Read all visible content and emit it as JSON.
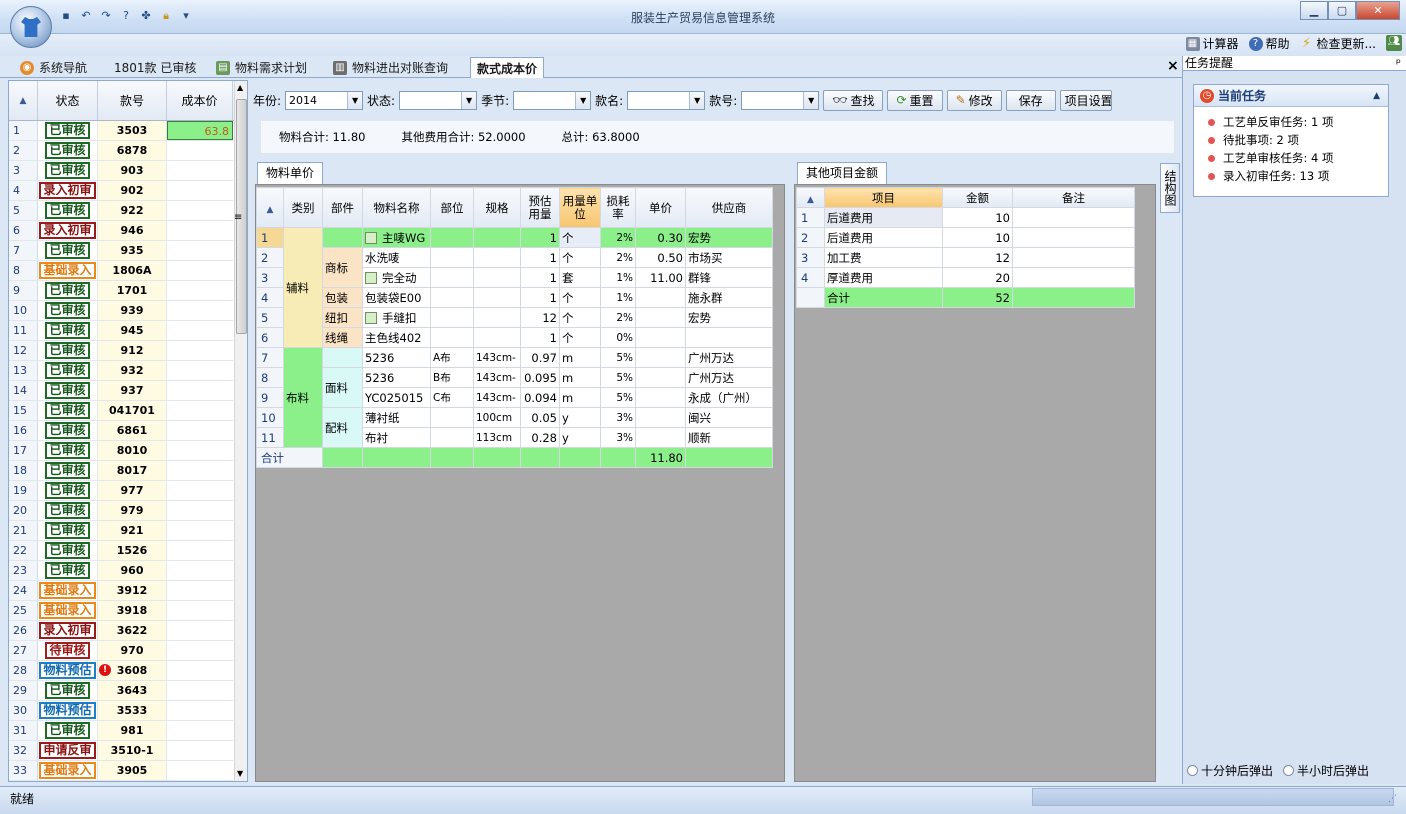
{
  "app": {
    "title": "服装生产贸易信息管理系统",
    "window_buttons": {
      "minimize": "▁",
      "maximize": "▢",
      "close": "✕"
    }
  },
  "toolbar_top": {
    "calculator": "计算器",
    "help": "帮助",
    "check_update": "检查更新..."
  },
  "tabs": [
    {
      "label": "系统导航"
    },
    {
      "label": "1801款 已审核"
    },
    {
      "label": "物料需求计划"
    },
    {
      "label": "物料进出对账查询"
    },
    {
      "label": "款式成本价"
    }
  ],
  "tab_close": "×",
  "left_list": {
    "headers": {
      "status": "状态",
      "style_no": "款号",
      "cost": "成本价"
    },
    "rows": [
      {
        "n": "1",
        "status": "已审核",
        "kind": "ok",
        "style": "3503",
        "cost": "63.8"
      },
      {
        "n": "2",
        "status": "已审核",
        "kind": "ok",
        "style": "6878",
        "cost": ""
      },
      {
        "n": "3",
        "status": "已审核",
        "kind": "ok",
        "style": "903",
        "cost": ""
      },
      {
        "n": "4",
        "status": "录入初审",
        "kind": "init",
        "style": "902",
        "cost": ""
      },
      {
        "n": "5",
        "status": "已审核",
        "kind": "ok",
        "style": "922",
        "cost": ""
      },
      {
        "n": "6",
        "status": "录入初审",
        "kind": "init",
        "style": "946",
        "cost": ""
      },
      {
        "n": "7",
        "status": "已审核",
        "kind": "ok",
        "style": "935",
        "cost": ""
      },
      {
        "n": "8",
        "status": "基础录入",
        "kind": "base",
        "style": "1806A",
        "cost": ""
      },
      {
        "n": "9",
        "status": "已审核",
        "kind": "ok",
        "style": "1701",
        "cost": ""
      },
      {
        "n": "10",
        "status": "已审核",
        "kind": "ok",
        "style": "939",
        "cost": ""
      },
      {
        "n": "11",
        "status": "已审核",
        "kind": "ok",
        "style": "945",
        "cost": ""
      },
      {
        "n": "12",
        "status": "已审核",
        "kind": "ok",
        "style": "912",
        "cost": ""
      },
      {
        "n": "13",
        "status": "已审核",
        "kind": "ok",
        "style": "932",
        "cost": ""
      },
      {
        "n": "14",
        "status": "已审核",
        "kind": "ok",
        "style": "937",
        "cost": ""
      },
      {
        "n": "15",
        "status": "已审核",
        "kind": "ok",
        "style": "041701",
        "cost": ""
      },
      {
        "n": "16",
        "status": "已审核",
        "kind": "ok",
        "style": "6861",
        "cost": ""
      },
      {
        "n": "17",
        "status": "已审核",
        "kind": "ok",
        "style": "8010",
        "cost": ""
      },
      {
        "n": "18",
        "status": "已审核",
        "kind": "ok",
        "style": "8017",
        "cost": ""
      },
      {
        "n": "19",
        "status": "已审核",
        "kind": "ok",
        "style": "977",
        "cost": ""
      },
      {
        "n": "20",
        "status": "已审核",
        "kind": "ok",
        "style": "979",
        "cost": ""
      },
      {
        "n": "21",
        "status": "已审核",
        "kind": "ok",
        "style": "921",
        "cost": ""
      },
      {
        "n": "22",
        "status": "已审核",
        "kind": "ok",
        "style": "1526",
        "cost": ""
      },
      {
        "n": "23",
        "status": "已审核",
        "kind": "ok",
        "style": "960",
        "cost": ""
      },
      {
        "n": "24",
        "status": "基础录入",
        "kind": "base",
        "style": "3912",
        "cost": ""
      },
      {
        "n": "25",
        "status": "基础录入",
        "kind": "base",
        "style": "3918",
        "cost": ""
      },
      {
        "n": "26",
        "status": "录入初审",
        "kind": "init",
        "style": "3622",
        "cost": ""
      },
      {
        "n": "27",
        "status": "待审核",
        "kind": "wait",
        "style": "970",
        "cost": ""
      },
      {
        "n": "28",
        "status": "物料预估",
        "kind": "est",
        "style": "3608",
        "cost": "",
        "warn": true
      },
      {
        "n": "29",
        "status": "已审核",
        "kind": "ok",
        "style": "3643",
        "cost": ""
      },
      {
        "n": "30",
        "status": "物料预估",
        "kind": "est",
        "style": "3533",
        "cost": ""
      },
      {
        "n": "31",
        "status": "已审核",
        "kind": "ok",
        "style": "981",
        "cost": ""
      },
      {
        "n": "32",
        "status": "申请反审",
        "kind": "rev",
        "style": "3510-1",
        "cost": ""
      },
      {
        "n": "33",
        "status": "基础录入",
        "kind": "base",
        "style": "3905",
        "cost": ""
      }
    ]
  },
  "filter": {
    "year_label": "年份:",
    "year_value": "2014",
    "status_label": "状态:",
    "status_value": "",
    "season_label": "季节:",
    "season_value": "",
    "name_label": "款名:",
    "name_value": "",
    "style_label": "款号:",
    "style_value": "",
    "search": "查找",
    "reset": "重置",
    "edit": "修改",
    "save": "保存",
    "project": "项目设置"
  },
  "summary": {
    "material_total": "物料合计:  11.80",
    "other_total": "其他费用合计:  52.0000",
    "grand_total": "总计:  63.8000"
  },
  "material_tab": "物料单价",
  "material_table": {
    "headers": [
      "类别",
      "部件",
      "物料名称",
      "部位",
      "规格",
      "预估用量",
      "用量单位",
      "损耗率",
      "单价",
      "供应商"
    ],
    "categories": [
      "辅料",
      "布料"
    ],
    "parts": [
      "商标",
      "包装",
      "纽扣",
      "线绳",
      "面料",
      "配料"
    ],
    "rows": [
      {
        "n": "1",
        "name": "主唛WG",
        "pos": "",
        "spec": "",
        "qty": "1",
        "unit": "个",
        "loss": "2%",
        "price": "0.30",
        "supplier": "宏势",
        "icon": true
      },
      {
        "n": "2",
        "name": "水洗唛",
        "pos": "",
        "spec": "",
        "qty": "1",
        "unit": "个",
        "loss": "2%",
        "price": "0.50",
        "supplier": "市场买"
      },
      {
        "n": "3",
        "name": "完全动",
        "pos": "",
        "spec": "",
        "qty": "1",
        "unit": "套",
        "loss": "1%",
        "price": "11.00",
        "supplier": "群锋",
        "icon": true
      },
      {
        "n": "4",
        "name": "包装袋E00",
        "pos": "",
        "spec": "",
        "qty": "1",
        "unit": "个",
        "loss": "1%",
        "price": "",
        "supplier": "施永群"
      },
      {
        "n": "5",
        "name": "手缝扣",
        "pos": "",
        "spec": "",
        "qty": "12",
        "unit": "个",
        "loss": "2%",
        "price": "",
        "supplier": "宏势",
        "icon": true
      },
      {
        "n": "6",
        "name": "主色线402",
        "pos": "",
        "spec": "",
        "qty": "1",
        "unit": "个",
        "loss": "0%",
        "price": "",
        "supplier": ""
      },
      {
        "n": "7",
        "name": "5236",
        "pos": "A布",
        "spec": "143cm-",
        "qty": "0.97",
        "unit": "m",
        "loss": "5%",
        "price": "",
        "supplier": "广州万达"
      },
      {
        "n": "8",
        "name": "5236",
        "pos": "B布",
        "spec": "143cm-",
        "qty": "0.095",
        "unit": "m",
        "loss": "5%",
        "price": "",
        "supplier": "广州万达"
      },
      {
        "n": "9",
        "name": "YC025015",
        "pos": "C布",
        "spec": "143cm-",
        "qty": "0.094",
        "unit": "m",
        "loss": "5%",
        "price": "",
        "supplier": "永成（广州）"
      },
      {
        "n": "10",
        "name": "薄衬纸",
        "pos": "",
        "spec": "100cm",
        "qty": "0.05",
        "unit": "y",
        "loss": "3%",
        "price": "",
        "supplier": "闽兴"
      },
      {
        "n": "11",
        "name": "布衬",
        "pos": "",
        "spec": "113cm",
        "qty": "0.28",
        "unit": "y",
        "loss": "3%",
        "price": "",
        "supplier": "顺新"
      }
    ],
    "total_label": "合计",
    "total_price": "11.80"
  },
  "other_tab": "其他项目金额",
  "other_table": {
    "headers": [
      "项目",
      "金额",
      "备注"
    ],
    "rows": [
      {
        "n": "1",
        "item": "后道费用",
        "amount": "10",
        "note": ""
      },
      {
        "n": "2",
        "item": "后道费用",
        "amount": "10",
        "note": ""
      },
      {
        "n": "3",
        "item": "加工费",
        "amount": "12",
        "note": ""
      },
      {
        "n": "4",
        "item": "厚道费用",
        "amount": "20",
        "note": ""
      }
    ],
    "total_label": "合计",
    "total_amount": "52"
  },
  "structure_button": "结构图",
  "right_panel": {
    "title": "任务提醒",
    "pin": "ᵖ",
    "current_tasks": "当前任务",
    "tasks": [
      "工艺单反审任务:  1 项",
      "待批事项:  2 项",
      "工艺单审核任务:  4 项",
      "录入初审任务:  13 项"
    ],
    "radio1": "十分钟后弹出",
    "radio2": "半小时后弹出"
  },
  "status_bar": "就绪",
  "colors": {
    "approved": "#1f6b25",
    "base": "#e88b1c",
    "init": "#9a1b1b",
    "estimate": "#1e7fc7",
    "highlight_green": "#8cf08a"
  }
}
